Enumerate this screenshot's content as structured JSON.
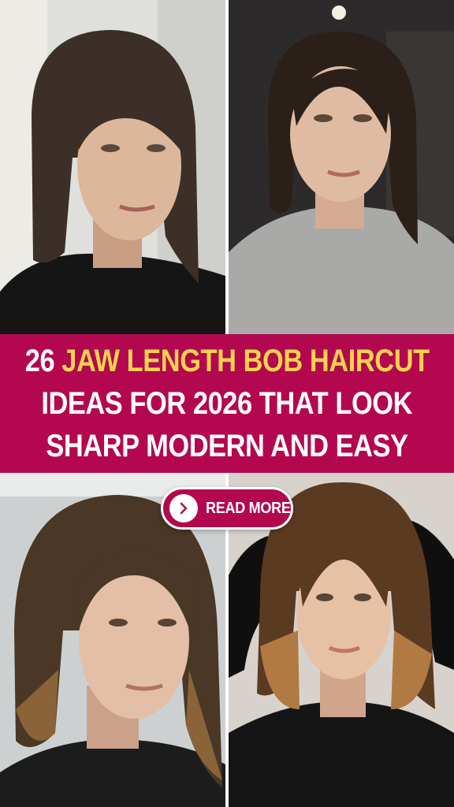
{
  "banner": {
    "line1_number": "26",
    "line1_highlight": "JAW LENGTH BOB HAIRCUT",
    "line2": "IDEAS FOR 2026 THAT LOOK",
    "line3": "SHARP MODERN AND EASY"
  },
  "cta": {
    "label": "READ MORE",
    "icon": "chevron-right-icon"
  },
  "colors": {
    "banner_bg": "#b3084f",
    "highlight": "#f7d24e",
    "text": "#ffffff"
  }
}
